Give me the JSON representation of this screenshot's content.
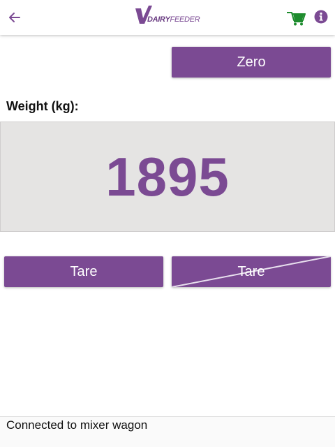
{
  "colors": {
    "primary": "#7b4a93",
    "cart": "#1e8c2e",
    "panel_bg": "#e5e4e3",
    "weight_text": "#7b4a93",
    "strike": "#e8e0ee"
  },
  "header": {
    "back_icon": "arrow-left-icon",
    "logo": {
      "text_bold": "DAIRY",
      "text_light": "FEEDER"
    },
    "cart_icon": "mixer-cart-icon",
    "info_icon": "info-icon"
  },
  "actions": {
    "zero_label": "Zero"
  },
  "weight": {
    "label": "Weight (kg):",
    "value": "1895"
  },
  "tare_buttons": {
    "tare_label": "Tare",
    "tare_disabled_label": "Tare"
  },
  "status": {
    "text": "Connected to mixer wagon"
  }
}
